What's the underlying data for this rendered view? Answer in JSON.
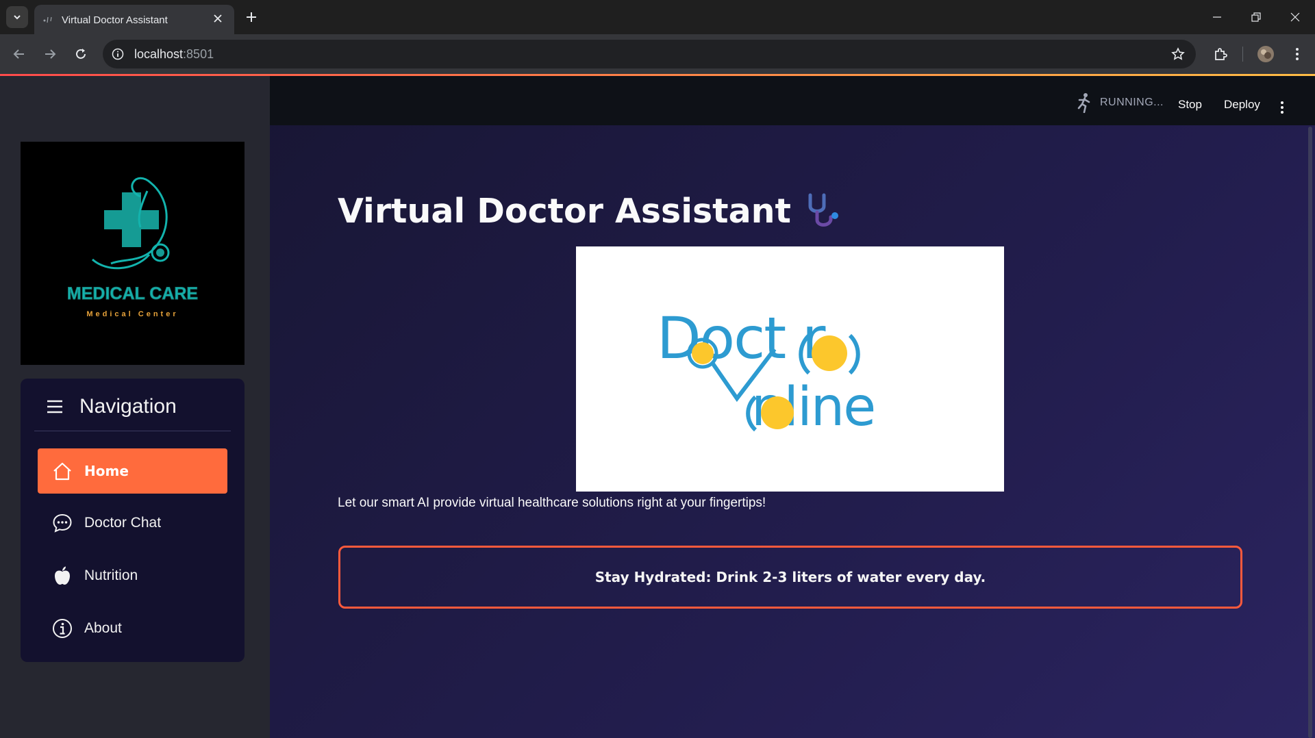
{
  "browser": {
    "tab_title": "Virtual Doctor Assistant",
    "url_host": "localhost",
    "url_port": ":8501"
  },
  "app_header": {
    "status": "RUNNING...",
    "stop_label": "Stop",
    "deploy_label": "Deploy"
  },
  "sidebar": {
    "logo": {
      "title": "MEDICAL CARE",
      "subtitle": "Medical Center"
    },
    "nav_title": "Navigation",
    "items": [
      {
        "label": "Home",
        "icon": "house-icon",
        "active": true
      },
      {
        "label": "Doctor Chat",
        "icon": "chat-bubble-icon",
        "active": false
      },
      {
        "label": "Nutrition",
        "icon": "apple-icon",
        "active": false
      },
      {
        "label": "About",
        "icon": "info-circle-icon",
        "active": false
      }
    ]
  },
  "main": {
    "title": "Virtual Doctor Assistant",
    "title_icon": "stethoscope-icon",
    "hero_image": {
      "line1": "Doct  r",
      "line2": "nline"
    },
    "tagline": "Let our smart AI provide virtual healthcare solutions right at your fingertips!",
    "tip": "Stay Hydrated: Drink 2-3 liters of water every day."
  },
  "colors": {
    "accent": "#ff6b3d",
    "tip_border": "#ff5a3c",
    "logo_teal": "#13b3ad",
    "logo_gold": "#e8a33a",
    "hero_blue": "#2d9bd1",
    "hero_yellow": "#fcc72c"
  }
}
